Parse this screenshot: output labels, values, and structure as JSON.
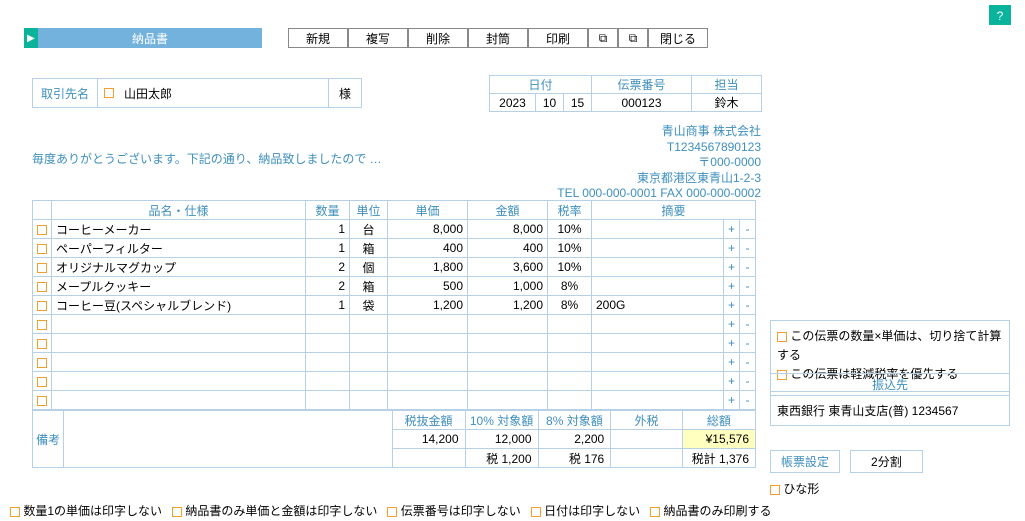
{
  "title": "納品書",
  "toolbar": {
    "new": "新規",
    "copy": "複写",
    "delete": "削除",
    "seal": "封筒",
    "print": "印刷",
    "close": "閉じる"
  },
  "partner": {
    "label": "取引先名",
    "name": "山田太郎",
    "suffix": "様"
  },
  "meta": {
    "date_label": "日付",
    "slip_label": "伝票番号",
    "staff_label": "担当",
    "year": "2023",
    "month": "10",
    "day": "15",
    "slip": "000123",
    "staff": "鈴木"
  },
  "company": {
    "name": "青山商事 株式会社",
    "reg": "T1234567890123",
    "zip": "〒000-0000",
    "addr": "東京都港区東青山1-2-3",
    "tel": "TEL 000-000-0001  FAX 000-000-0002"
  },
  "greeting": "毎度ありがとうございます。下記の通り、納品致しましたので …",
  "headers": {
    "name": "品名・仕様",
    "qty": "数量",
    "unit": "単位",
    "price": "単価",
    "amount": "金額",
    "tax": "税率",
    "note": "摘要"
  },
  "rows": [
    {
      "name": "コーヒーメーカー",
      "qty": "1",
      "unit": "台",
      "price": "8,000",
      "amount": "8,000",
      "tax": "10%",
      "note": ""
    },
    {
      "name": "ペーパーフィルター",
      "qty": "1",
      "unit": "箱",
      "price": "400",
      "amount": "400",
      "tax": "10%",
      "note": ""
    },
    {
      "name": "オリジナルマグカップ",
      "qty": "2",
      "unit": "個",
      "price": "1,800",
      "amount": "3,600",
      "tax": "10%",
      "note": ""
    },
    {
      "name": "メープルクッキー",
      "qty": "2",
      "unit": "箱",
      "price": "500",
      "amount": "1,000",
      "tax": "8%",
      "note": ""
    },
    {
      "name": "コーヒー豆(スペシャルブレンド)",
      "qty": "1",
      "unit": "袋",
      "price": "1,200",
      "amount": "1,200",
      "tax": "8%",
      "note": "200G"
    },
    {},
    {},
    {},
    {},
    {}
  ],
  "totals": {
    "remark_label": "備考",
    "subtotal_label": "税抜金額",
    "t10_label": "10% 対象額",
    "t8_label": "8% 対象額",
    "ext_label": "外税",
    "grand_label": "総額",
    "subtotal": "14,200",
    "t10": "12,000",
    "t8": "2,200",
    "grand": "¥15,576",
    "tax10_label": "税 1,200",
    "tax8_label": "税 176",
    "tax_total": "税計 1,376"
  },
  "side": {
    "opt1": "この伝票の数量×単価は、切り捨て計算する",
    "opt2": "この伝票は軽減税率を優先する",
    "bank_label": "振込先",
    "bank": "東西銀行  東青山支店(普) 1234567",
    "form_label": "帳票設定",
    "form_value": "2分割",
    "template": "ひな形"
  },
  "bottom": {
    "c1": "数量1の単価は印字しない",
    "c2": "納品書のみ単価と金額は印字しない",
    "c3": "伝票番号は印字しない",
    "c4": "日付は印字しない",
    "c5": "納品書のみ印刷する"
  },
  "help": "?"
}
